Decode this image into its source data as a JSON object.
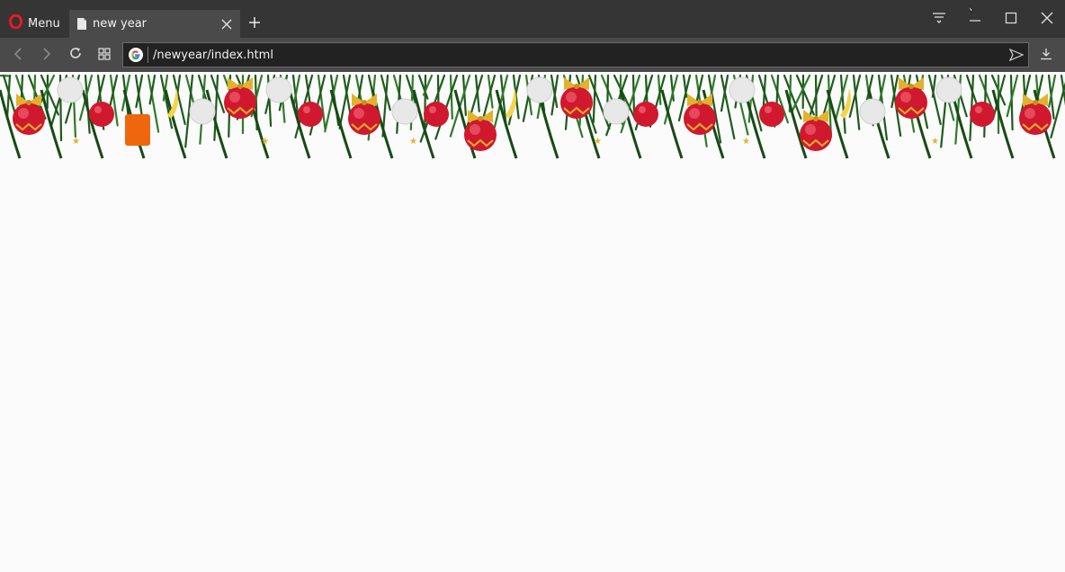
{
  "browser": {
    "menu_label": "Menu",
    "tab": {
      "title": "new year"
    },
    "address": {
      "url": "/newyear/index.html"
    }
  },
  "icons": {
    "opera": "opera-logo",
    "document": "document-icon",
    "close": "close-icon",
    "new_tab": "plus-icon",
    "easy_setup": "easy-setup-icon",
    "minimize": "minimize-icon",
    "maximize": "maximize-icon",
    "window_close": "window-close-icon",
    "back": "back-arrow-icon",
    "forward": "forward-arrow-icon",
    "reload": "reload-icon",
    "tabs_grid": "grid-icon",
    "search_engine": "google-icon",
    "send": "send-icon",
    "download": "download-icon"
  },
  "colors": {
    "tab_strip": "#353535",
    "toolbar": "#4a4a4a",
    "page_background": "#fbfbfb",
    "ornament_red": "#d0182e",
    "ornament_gold": "#e2b22c",
    "pine": "#1f5a1c",
    "orange_block": "#f0660c"
  }
}
